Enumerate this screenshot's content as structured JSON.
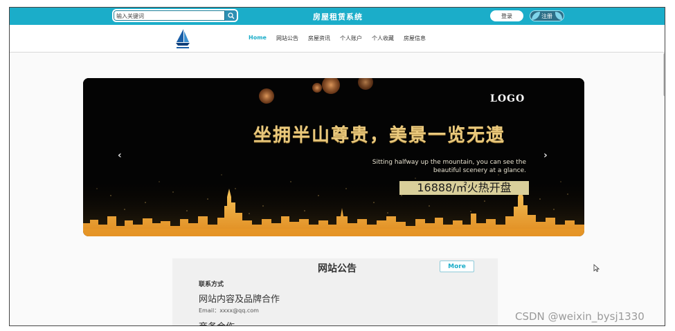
{
  "header": {
    "search_placeholder": "输入关键词",
    "site_title": "房屋租赁系统",
    "login_label": "登录",
    "register_label": "注册"
  },
  "nav": {
    "items": [
      {
        "label": "Home",
        "active": true
      },
      {
        "label": "网站公告",
        "active": false
      },
      {
        "label": "房屋资讯",
        "active": false
      },
      {
        "label": "个人账户",
        "active": false
      },
      {
        "label": "个人收藏",
        "active": false
      },
      {
        "label": "房屋信息",
        "active": false
      }
    ]
  },
  "banner": {
    "logo_text": "LOGO",
    "headline": "坐拥半山尊贵，美景一览无遗",
    "subtitle_line1": "Sitting halfway up the mountain, you can see the",
    "subtitle_line2": "beautiful scenery at a glance.",
    "price": "16888/㎡火热开盘",
    "prev_arrow": "‹",
    "next_arrow": "›"
  },
  "notice": {
    "title": "网站公告",
    "more_label": "More",
    "contact_label": "联系方式",
    "cooperation_title": "网站内容及品牌合作",
    "email": "Email：xxxx@qq.com",
    "business_title": "商务合作"
  },
  "watermark": "CSDN @weixin_bysj1330",
  "colors": {
    "topbar": "#1badc9",
    "nav_active": "#1badc9",
    "headline_gold": "#e9c87c",
    "price_bg": "#d9cf9a"
  }
}
